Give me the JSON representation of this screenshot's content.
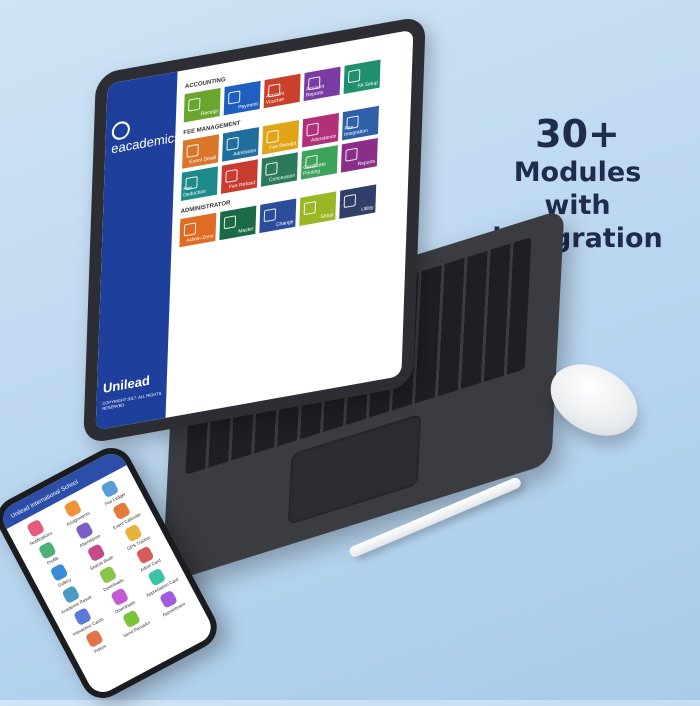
{
  "headline": {
    "big": "30+",
    "line1": "Modules",
    "line2": "with",
    "line3": "integration"
  },
  "tablet": {
    "brand": "eacademics",
    "footer_brand": "Unilead",
    "copyright": "COPYRIGHT 2017. ALL RIGHTS RESERVED",
    "sections": [
      {
        "title": "ACCOUNTING",
        "tiles": [
          {
            "label": "Receipt",
            "color": "#6aa62e"
          },
          {
            "label": "Payment",
            "color": "#1f5fbf"
          },
          {
            "label": "Account Voucher",
            "color": "#c9412b"
          },
          {
            "label": "Account Reports",
            "color": "#7a3ca3"
          },
          {
            "label": "FA Setup",
            "color": "#1f8f6e"
          }
        ]
      },
      {
        "title": "FEE MANAGEMENT",
        "tiles": [
          {
            "label": "Event Detail",
            "color": "#d9762a"
          },
          {
            "label": "Admission",
            "color": "#1f6e9e"
          },
          {
            "label": "Fee Receipt",
            "color": "#e0a516"
          },
          {
            "label": "Attendance",
            "color": "#b2307a"
          },
          {
            "label": "Fee Integration",
            "color": "#2e5fa8"
          },
          {
            "label": "Fee Deduction",
            "color": "#1d8a8a"
          },
          {
            "label": "Fee Refund",
            "color": "#c93a2f"
          },
          {
            "label": "Concession",
            "color": "#2b7a5a"
          },
          {
            "label": "Certificate Printing",
            "color": "#3ca35a"
          },
          {
            "label": "Reports",
            "color": "#8a2e8a"
          }
        ]
      },
      {
        "title": "ADMINISTRATOR",
        "tiles": [
          {
            "label": "Admin Zone",
            "color": "#e06b23"
          },
          {
            "label": "Master",
            "color": "#1a6b45"
          },
          {
            "label": "Change",
            "color": "#2c4d9c"
          },
          {
            "label": "Setup",
            "color": "#9ab825"
          },
          {
            "label": "Utility",
            "color": "#2f3f6a"
          }
        ]
      }
    ]
  },
  "phone": {
    "header": "Unilead International School",
    "items": [
      {
        "label": "Notifications",
        "color": "#e45a7a"
      },
      {
        "label": "Assignments",
        "color": "#f0923a"
      },
      {
        "label": "Fee Ledger",
        "color": "#5a9bd8"
      },
      {
        "label": "Profile",
        "color": "#4fb07a"
      },
      {
        "label": "Attendance",
        "color": "#7a5fc4"
      },
      {
        "label": "Event Calendar",
        "color": "#e67a3a"
      },
      {
        "label": "Gallery",
        "color": "#3a8ad8"
      },
      {
        "label": "Search Book",
        "color": "#c44a8a"
      },
      {
        "label": "GPS Tracker",
        "color": "#e6b23a"
      },
      {
        "label": "Academic Result",
        "color": "#4a9bc4"
      },
      {
        "label": "Downloads",
        "color": "#8ac44a"
      },
      {
        "label": "Admit Card",
        "color": "#d85a5a"
      },
      {
        "label": "Interaction Cards",
        "color": "#5a7ad8"
      },
      {
        "label": "Downloads",
        "color": "#c45ad8"
      },
      {
        "label": "Appreciation Card",
        "color": "#3ac4a4"
      },
      {
        "label": "Videos",
        "color": "#e0754a"
      },
      {
        "label": "Send Remarks",
        "color": "#7ac43a"
      },
      {
        "label": "Appointment",
        "color": "#a45ae0"
      }
    ]
  }
}
